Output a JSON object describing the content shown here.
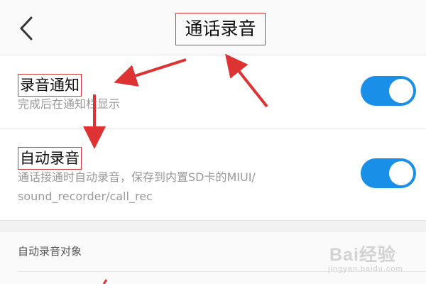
{
  "header": {
    "title": "通话录音",
    "back_icon": "chevron-left-icon"
  },
  "settings": [
    {
      "title": "录音通知",
      "desc": "完成后在通知栏显示",
      "enabled": true
    },
    {
      "title": "自动录音",
      "desc_line1": "通话接通时自动录音，保存到内置SD卡的MIUI/",
      "desc_line2": "sound_recorder/call_rec",
      "enabled": true
    }
  ],
  "section": {
    "label": "自动录音对象"
  },
  "watermark": {
    "text": "Bai经验",
    "sub": "jingyan.baidu.com"
  },
  "colors": {
    "toggle_on": "#1a8fe8",
    "annotation": "#dd3333"
  }
}
